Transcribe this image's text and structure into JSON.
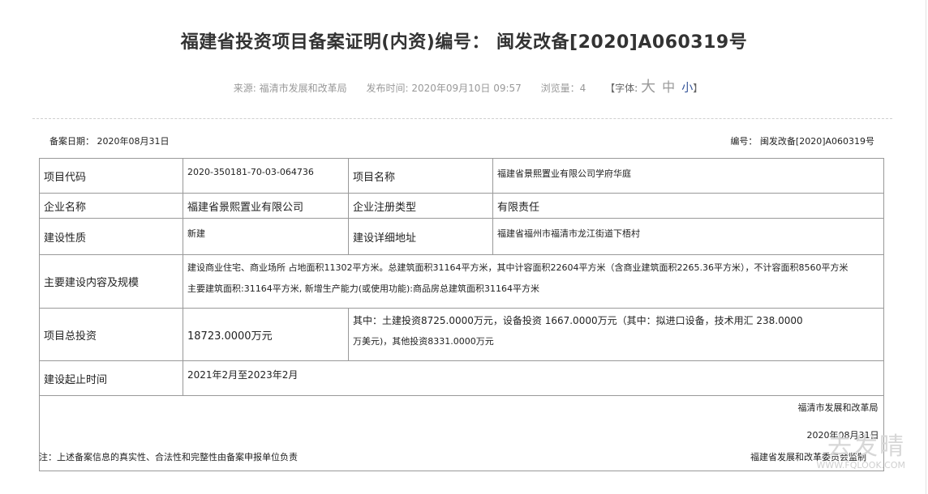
{
  "header": {
    "title": "福建省投资项目备案证明(内资)编号： 闽发改备[2020]A060319号",
    "source": "来源: 福清市发展和改革局",
    "publish_time": "发布时间: 2020年09月10日 09:57",
    "views": "浏览量：4",
    "font_label_open": "【字体:",
    "font_big": "大",
    "font_mid": "中",
    "font_small": "小",
    "font_label_close": "】"
  },
  "record": {
    "date": "备案日期： 2020年08月31日",
    "number": "编号： 闽发改备[2020]A060319号"
  },
  "table": {
    "project_code_label": "项目代码",
    "project_code": "2020-350181-70-03-064736",
    "project_name_label": "项目名称",
    "project_name": "福建省景熙置业有限公司学府华庭",
    "company_label": "企业名称",
    "company": "福建省景熙置业有限公司",
    "reg_type_label": "企业注册类型",
    "reg_type": "有限责任",
    "nature_label": "建设性质",
    "nature": "新建",
    "address_label": "建设详细地址",
    "address": "福建省福州市福清市龙江街道下梧村",
    "content_label": "主要建设内容及规模",
    "content_line1": "建设商业住宅、商业场所 占地面积11302平方米。总建筑面积31164平方米，其中计容面积22604平方米（含商业建筑面积2265.36平方米），不计容面积8560平方米",
    "content_line2": "主要建筑面积:31164平方米, 新增生产能力(或使用功能):商品房总建筑面积31164平方米",
    "investment_label": "项目总投资",
    "investment": "18723.0000万元",
    "investment_detail_line1": "其中：土建投资8725.0000万元，设备投资 1667.0000万元（其中：拟进口设备，技术用汇 238.0000",
    "investment_detail_line2": "万美元)，其他投资8331.0000万元",
    "period_label": "建设起止时间",
    "period": "2021年2月至2023年2月",
    "sign_org": "福清市发展和改革局",
    "sign_date": "2020年08月31日"
  },
  "footer": {
    "note": "注：上述备案信息的真实性、合法性和完整性由备案申报单位负责",
    "issuer": "福建省发展和改革委员会监制"
  },
  "watermark": {
    "text": "去发晴",
    "url": "WWW.FQLOOK.COM"
  }
}
